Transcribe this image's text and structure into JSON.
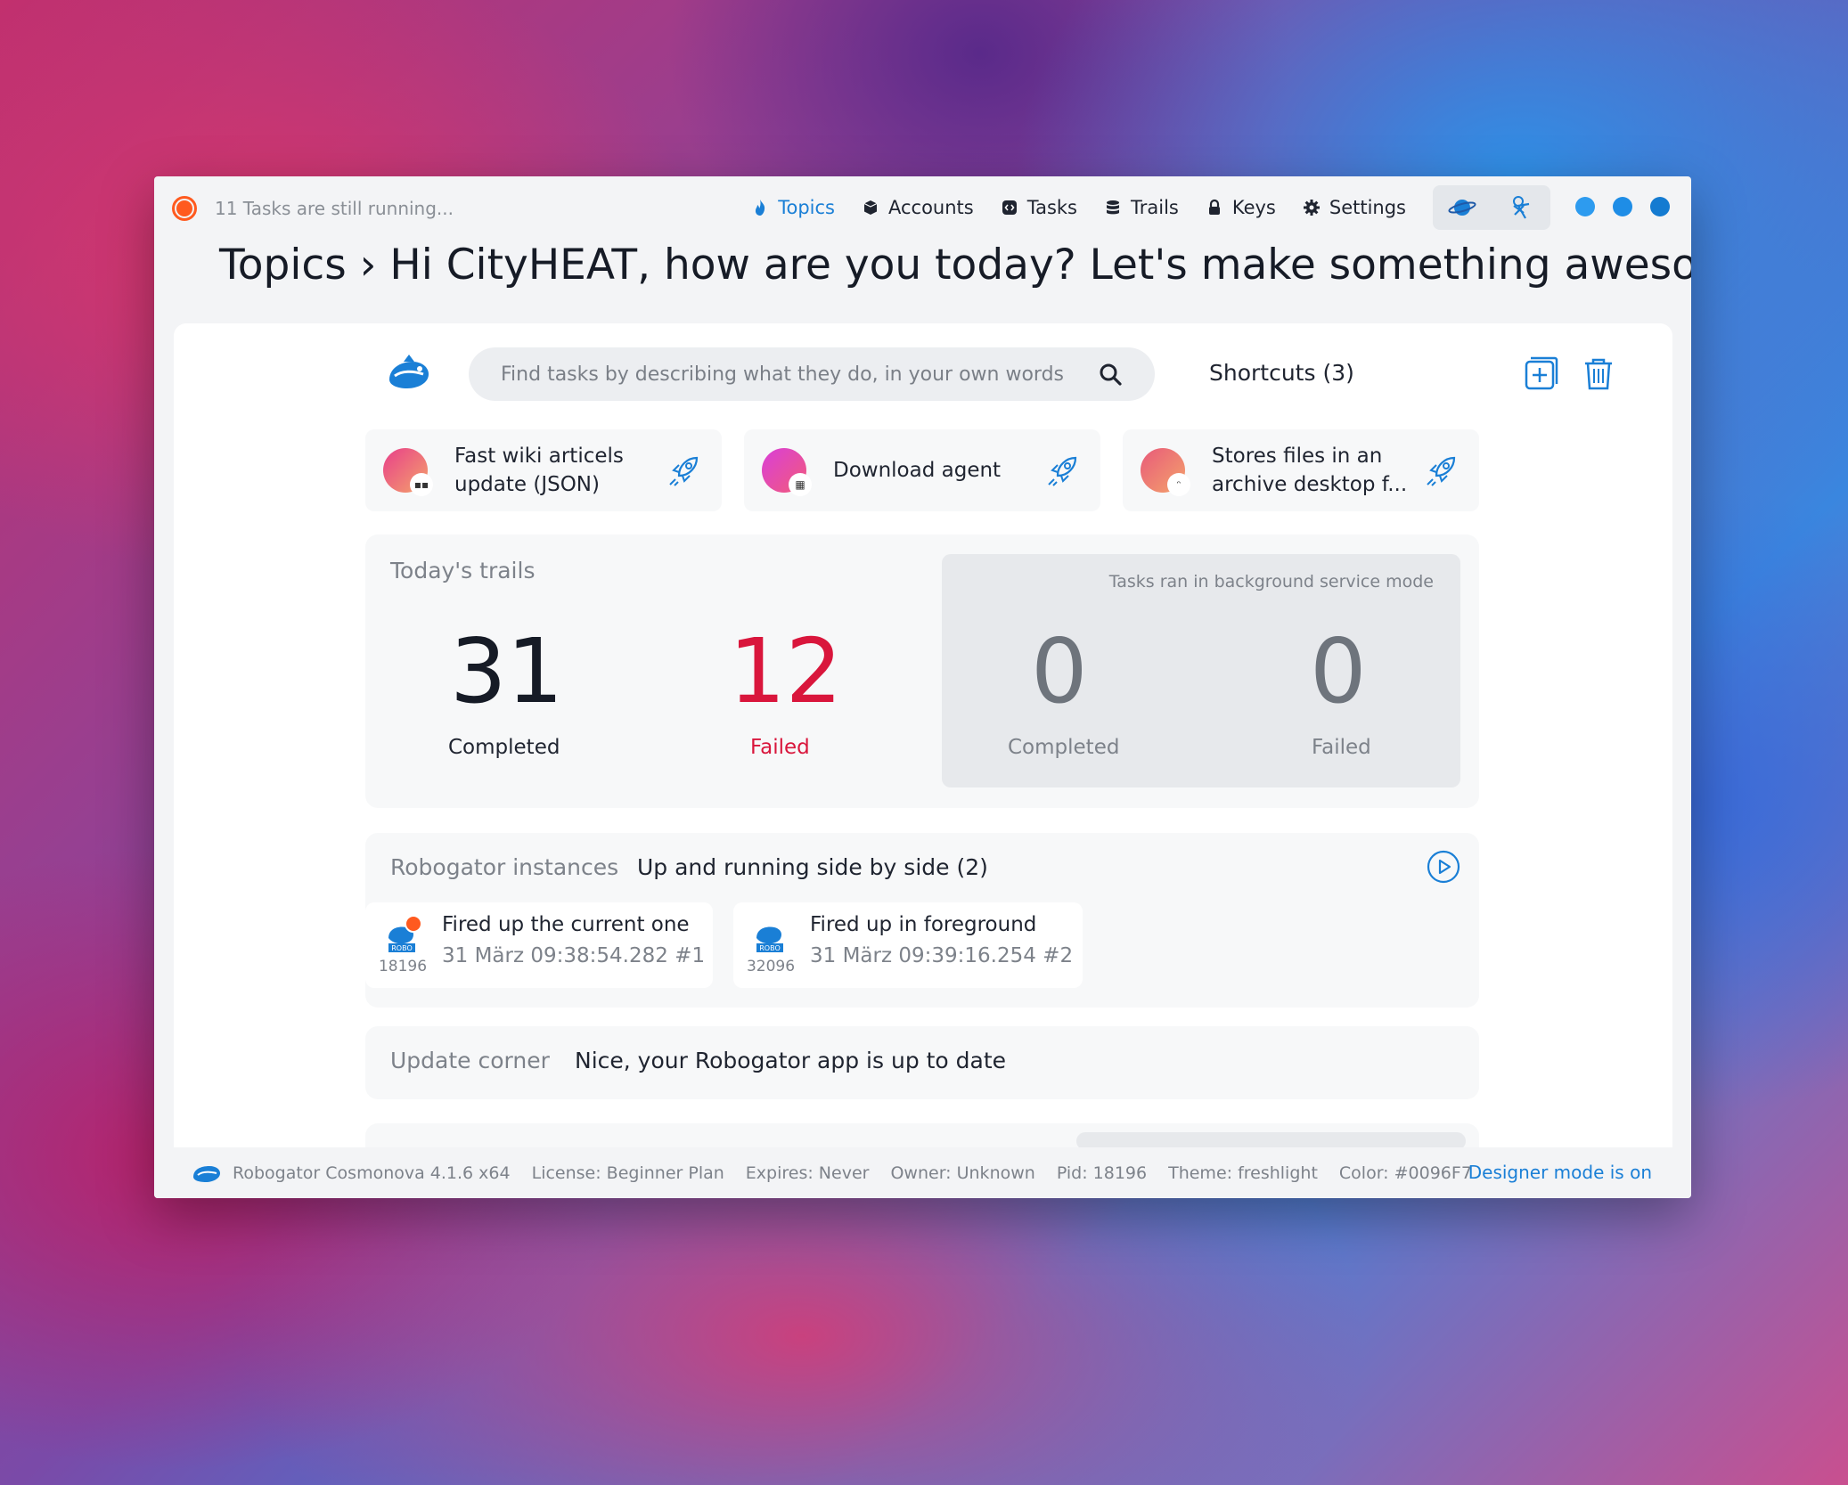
{
  "status": {
    "running_text": "11 Tasks are still running..."
  },
  "nav": {
    "items": [
      {
        "label": "Topics",
        "icon": "flame-icon",
        "active": true
      },
      {
        "label": "Accounts",
        "icon": "cube-icon",
        "active": false
      },
      {
        "label": "Tasks",
        "icon": "code-icon",
        "active": false
      },
      {
        "label": "Trails",
        "icon": "database-icon",
        "active": false
      },
      {
        "label": "Keys",
        "icon": "lock-icon",
        "active": false
      },
      {
        "label": "Settings",
        "icon": "gear-icon",
        "active": false
      }
    ]
  },
  "window_controls": {
    "colors": [
      "#2d9bef",
      "#1e8de6",
      "#147bd1"
    ]
  },
  "page": {
    "title": "Topics › Hi CityHEAT, how are you today? Let's make something awesome..."
  },
  "search": {
    "placeholder": "Find tasks by describing what they do, in your own words"
  },
  "shortcuts": {
    "label": "Shortcuts (3)",
    "cards": [
      {
        "label": "Fast wiki articels update (JSON)",
        "avatar_colors": [
          "#f2577a",
          "#f4a36b"
        ]
      },
      {
        "label": "Download agent",
        "avatar_colors": [
          "#e83fd6",
          "#f25a7a"
        ]
      },
      {
        "label": "Stores files in an archive desktop f...",
        "avatar_colors": [
          "#f2577a",
          "#f4a36b"
        ]
      }
    ]
  },
  "trails": {
    "title": "Today's trails",
    "completed": {
      "value": "31",
      "label": "Completed"
    },
    "failed": {
      "value": "12",
      "label": "Failed"
    },
    "background": {
      "title": "Tasks ran in background service mode",
      "completed": {
        "value": "0",
        "label": "Completed"
      },
      "failed": {
        "value": "0",
        "label": "Failed"
      }
    }
  },
  "instances": {
    "title": "Robogator instances",
    "subtitle": "Up and running side by side (2)",
    "items": [
      {
        "name": "Fired up the current one",
        "time": "31 März 09:38:54.282 #1",
        "pid": "18196",
        "current": true
      },
      {
        "name": "Fired up in foreground",
        "time": "31 März 09:39:16.254 #2",
        "pid": "32096",
        "current": false
      }
    ]
  },
  "update": {
    "title": "Update corner",
    "text": "Nice, your Robogator app is up to date"
  },
  "footer": {
    "items": [
      "Robogator Cosmonova 4.1.6 x64",
      "License: Beginner Plan",
      "Expires: Never",
      "Owner: Unknown",
      "Pid: 18196",
      "Theme: freshlight",
      "Color: #0096F7"
    ],
    "designer": "Designer mode is on"
  },
  "colors": {
    "accent": "#1a7fd6",
    "failed": "#d9163c",
    "running": "#ff5a1f"
  }
}
